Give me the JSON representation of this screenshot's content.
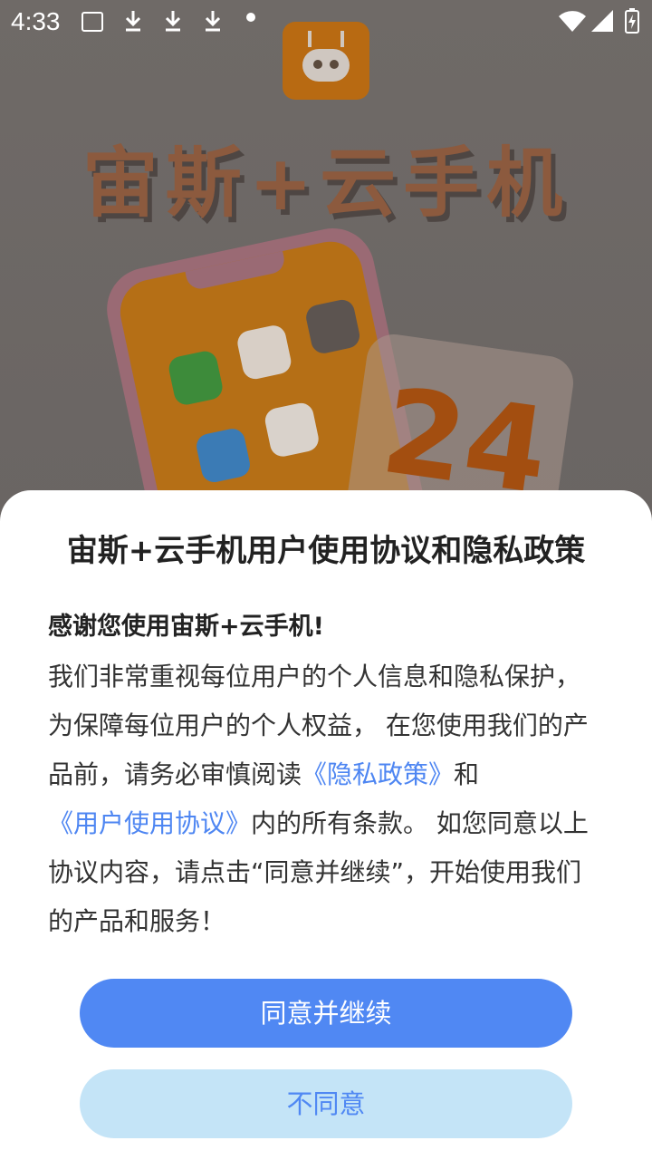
{
  "status_bar": {
    "time": "4:33",
    "icons": [
      "image-icon",
      "download-icon",
      "download-icon",
      "download-icon",
      "dot-icon",
      "wifi-icon",
      "signal-icon",
      "battery-charging-icon"
    ]
  },
  "splash": {
    "title": "宙斯+云手机",
    "badge": "24"
  },
  "dialog": {
    "title": "宙斯+云手机用户使用协议和隐私政策",
    "greeting": "感谢您使用宙斯+云手机!",
    "body_part1": "我们非常重视每位用户的个人信息和隐私保护，为保障每位用户的个人权益， 在您使用我们的产品前，请务必审慎阅读",
    "privacy_link": "《隐私政策》",
    "and_text": "和",
    "agreement_link": "《用户使用协议》",
    "body_part2": "内的所有条款。 如您同意以上协议内容，请点击“同意并继续”，开始使用我们的产品和服务！",
    "agree_button": "同意并继续",
    "decline_button": "不同意"
  },
  "colors": {
    "accent": "#5088f3",
    "link": "#4e86f2",
    "decline_bg": "#c4e4f7"
  }
}
